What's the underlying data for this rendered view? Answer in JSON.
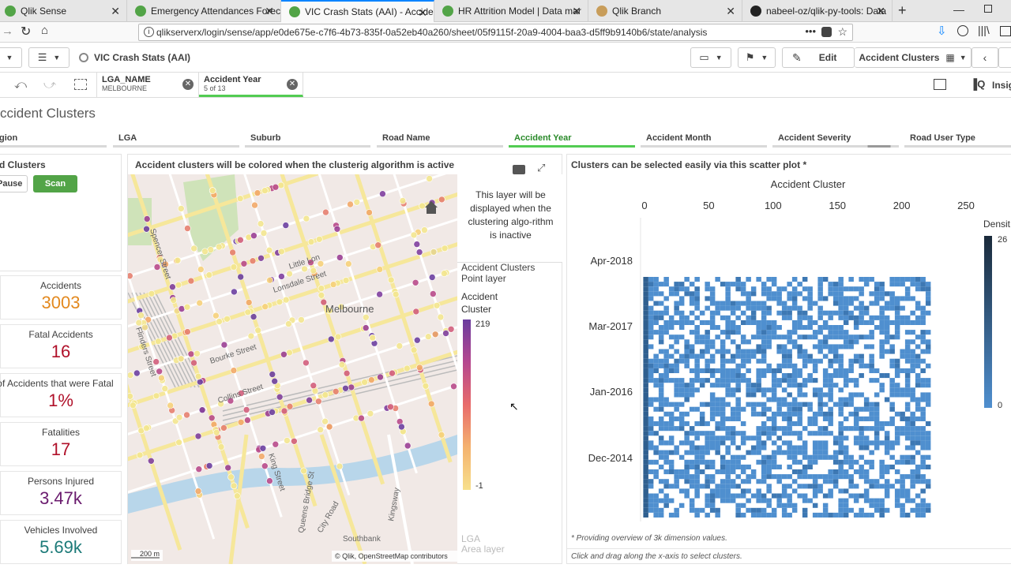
{
  "browser": {
    "tabs": [
      {
        "label": "Qlik Sense",
        "color": "#52a447"
      },
      {
        "label": "Emergency Attendances Forec",
        "color": "#52a447"
      },
      {
        "label": "VIC Crash Stats (AAI) - Accide",
        "color": "#52a447"
      },
      {
        "label": "HR Attrition Model | Data mar",
        "color": "#52a447"
      },
      {
        "label": "Qlik Branch",
        "color": "#c89d5a"
      },
      {
        "label": "nabeel-oz/qlik-py-tools: Data",
        "color": "#222222"
      }
    ],
    "url": "qlikserverx/login/sense/app/e0de675e-c7f6-4b73-835f-0a52eb40a260/sheet/05f9115f-20a9-4004-baa3-d5ff9b9140b6/state/analysis"
  },
  "toolbar": {
    "app_title": "VIC Crash Stats (AAI)",
    "edit_label": "Edit",
    "sheet_name": "Accident Clusters",
    "insights_label": "Insig"
  },
  "selections": [
    {
      "field": "LGA_NAME",
      "value": "MELBOURNE"
    },
    {
      "field": "Accident Year",
      "value": "5 of 13"
    }
  ],
  "sheet": {
    "title": "ccident Clusters",
    "filters": [
      "gion",
      "LGA",
      "Suburb",
      "Road Name",
      "Accident Year",
      "Accident Month",
      "Accident Severity",
      "Road User Type"
    ]
  },
  "left_panel": {
    "title": "d Clusters",
    "pause_label": "Pause",
    "scan_label": "Scan",
    "kpis": [
      {
        "label": "Accidents",
        "value": "3003",
        "color": "#e3891f"
      },
      {
        "label": "Fatal Accidents",
        "value": "16",
        "color": "#b0112a"
      },
      {
        "label": "of Accidents that were Fatal",
        "value": "1%",
        "color": "#b0112a"
      },
      {
        "label": "Fatalities",
        "value": "17",
        "color": "#b0112a"
      },
      {
        "label": "Persons Injured",
        "value": "3.47k",
        "color": "#6a1b6e"
      },
      {
        "label": "Vehicles Involved",
        "value": "5.69k",
        "color": "#1c7a78"
      }
    ]
  },
  "map_panel": {
    "title": "Accident clusters will be colored when the clusterig algorithm is active",
    "inactive_note": "This layer will be displayed when the clustering algo-rithm is inactive",
    "layer_name": "Accident Clusters Point layer",
    "legend_title": "Accident Cluster",
    "legend_max": "219",
    "legend_min": "-1",
    "area_layer_title": "LGA",
    "area_layer_sub": "Area layer",
    "scale_label": "200 m",
    "attribution": "© Qlik, OpenStreetMap contributors",
    "place_label": "Melbourne",
    "streets": [
      "Little Lon",
      "Lonsdale Street",
      "Bourke Street",
      "Collins Street",
      "King Street",
      "Spencer Street",
      "Flinders Street",
      "Queen Street",
      "Elizabeth Street",
      "Swanston Street",
      "Russell Street",
      "Exhibition Street",
      "Southbank",
      "City Road",
      "Kingsway",
      "Queens Bridge St"
    ]
  },
  "scatter_panel": {
    "title": "Clusters can be selected easily via this scatter plot *",
    "footnote": "* Providing overview of 3k dimension values.",
    "hint": "Click and drag along the x-axis to select clusters.",
    "density_label": "Densit",
    "density_max": "26",
    "density_min": "0",
    "color_high": "#1a2a3a",
    "color_low": "#4f8fcf"
  },
  "chart_data": {
    "type": "heatmap",
    "title": "",
    "xlabel": "Accident Cluster",
    "ylabel": "",
    "x_ticks": [
      "0",
      "50",
      "100",
      "150",
      "200",
      "250"
    ],
    "xlim": [
      0,
      250
    ],
    "y_ticks": [
      "Apr-2018",
      "Mar-2017",
      "Jan-2016",
      "Dec-2014"
    ],
    "legend": {
      "title": "Densit",
      "min": 0,
      "max": 26
    },
    "data_extent": {
      "x": [
        -1,
        219
      ],
      "y": [
        "Dec-2013",
        "Dec-2018"
      ]
    }
  }
}
